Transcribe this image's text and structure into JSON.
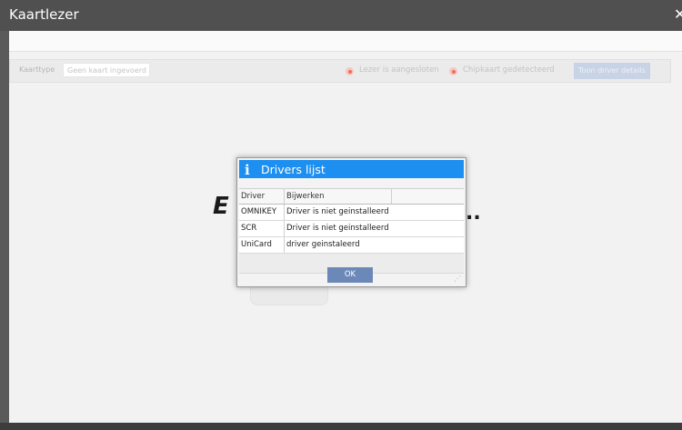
{
  "window": {
    "title": "Kaartlezer",
    "close_icon": "close-icon"
  },
  "toolbar": {
    "card_type_label": "Kaarttype",
    "card_type_value": "Geen kaart ingevoerd",
    "reader_status": "Lezer is aangesloten",
    "chip_status": "Chipkaart gedetecteerd",
    "driver_details_button": "Toon driver details",
    "status_color": "#ea6f5f"
  },
  "background": {
    "text_fragment": "E",
    "trailing_dots": ".."
  },
  "dialog": {
    "title": "Drivers lijst",
    "icon": "info-icon",
    "header_color": "#1d8ff0",
    "columns": [
      "Driver",
      "Bijwerken"
    ],
    "rows": [
      {
        "driver": "OMNIKEY",
        "status": "Driver is niet geinstalleerd"
      },
      {
        "driver": "SCR",
        "status": "Driver is niet geinstalleerd"
      },
      {
        "driver": "UniCard",
        "status": "driver geinstaleerd"
      }
    ],
    "ok_label": "OK",
    "ok_color": "#6c88b8"
  }
}
